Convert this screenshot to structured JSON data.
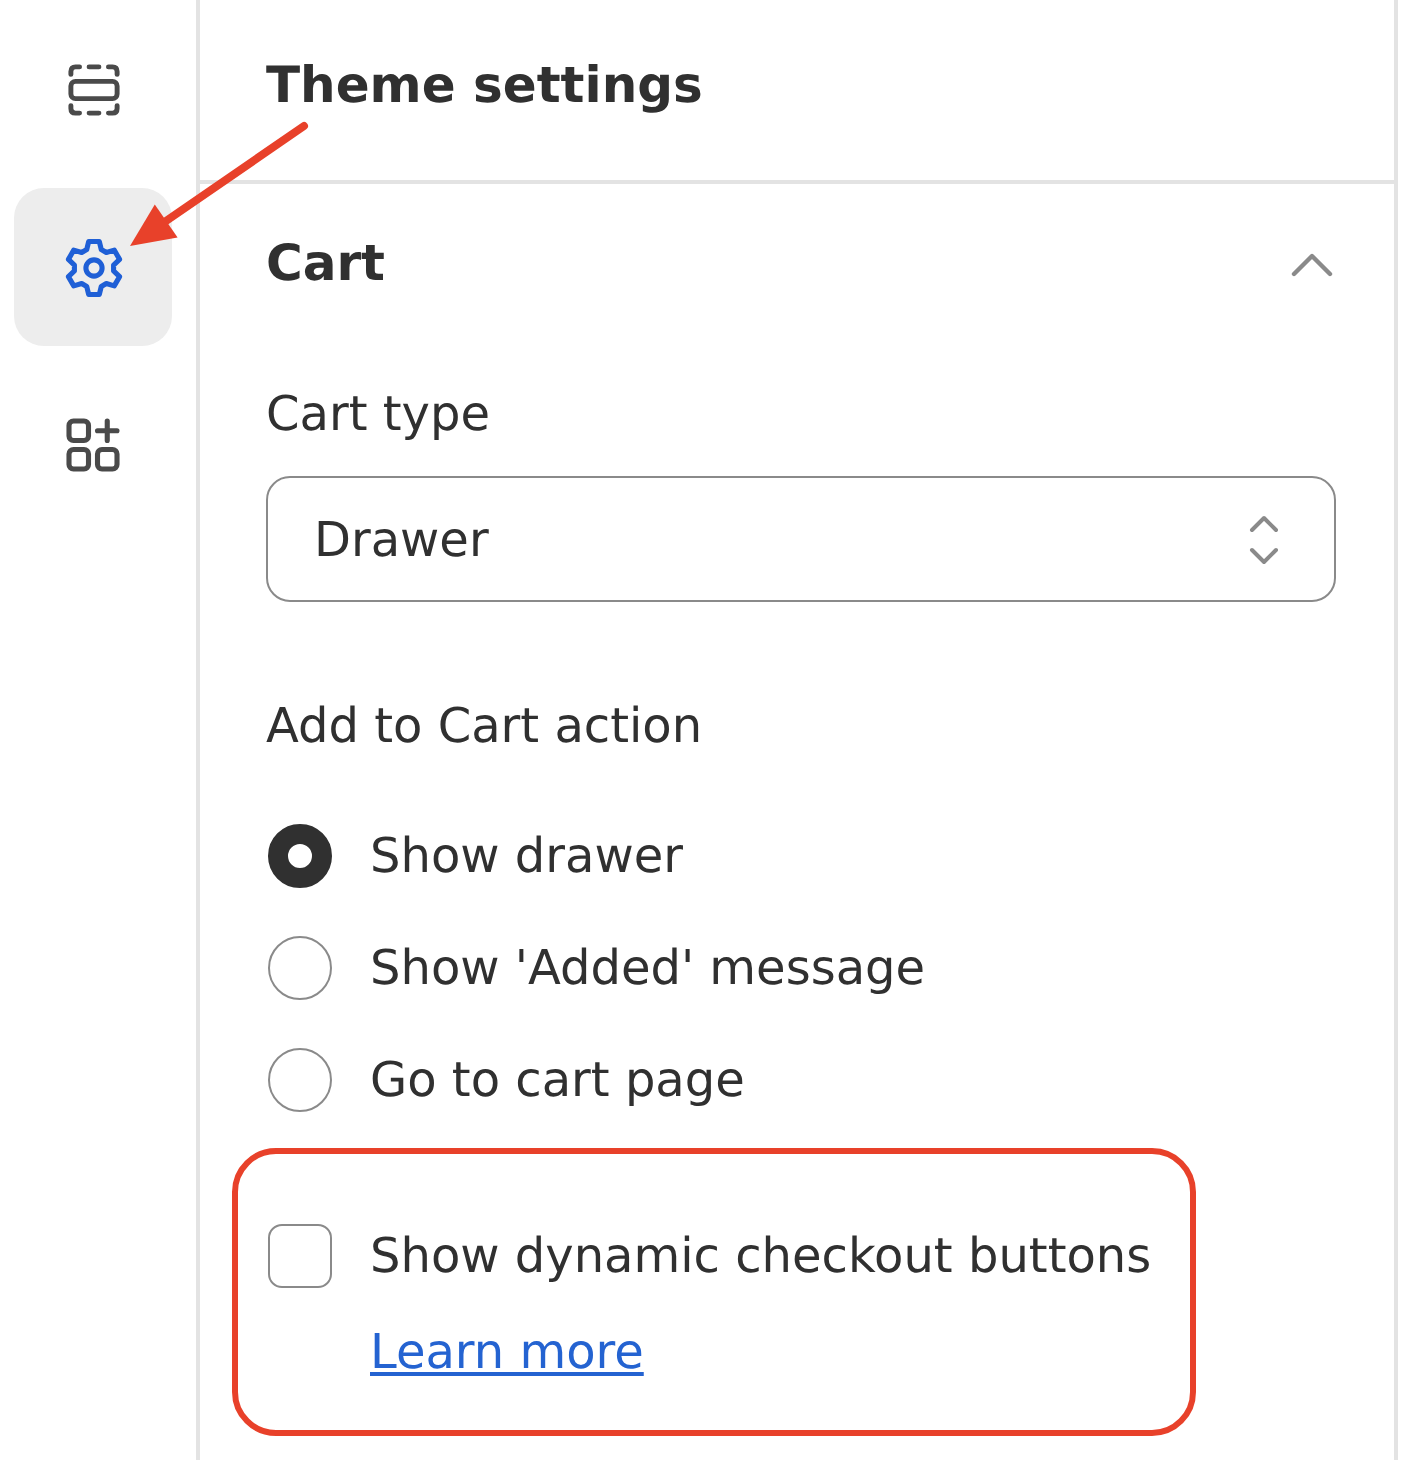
{
  "sidebar": {
    "items": [
      {
        "selected": false,
        "callout": false
      },
      {
        "selected": true,
        "callout": true
      },
      {
        "selected": false,
        "callout": false
      }
    ]
  },
  "panel": {
    "title": "Theme settings"
  },
  "section": {
    "title": "Cart",
    "expanded": true,
    "cart_type": {
      "label": "Cart type",
      "value": "Drawer"
    },
    "add_to_cart_action": {
      "label": "Add to Cart action",
      "options": [
        {
          "label": "Show drawer",
          "selected": true
        },
        {
          "label": "Show 'Added' message",
          "selected": false
        },
        {
          "label": "Go to cart page",
          "selected": false
        }
      ]
    },
    "dynamic_checkout": {
      "label": "Show dynamic checkout buttons",
      "checked": false,
      "highlighted": true,
      "link": "Learn more"
    }
  }
}
